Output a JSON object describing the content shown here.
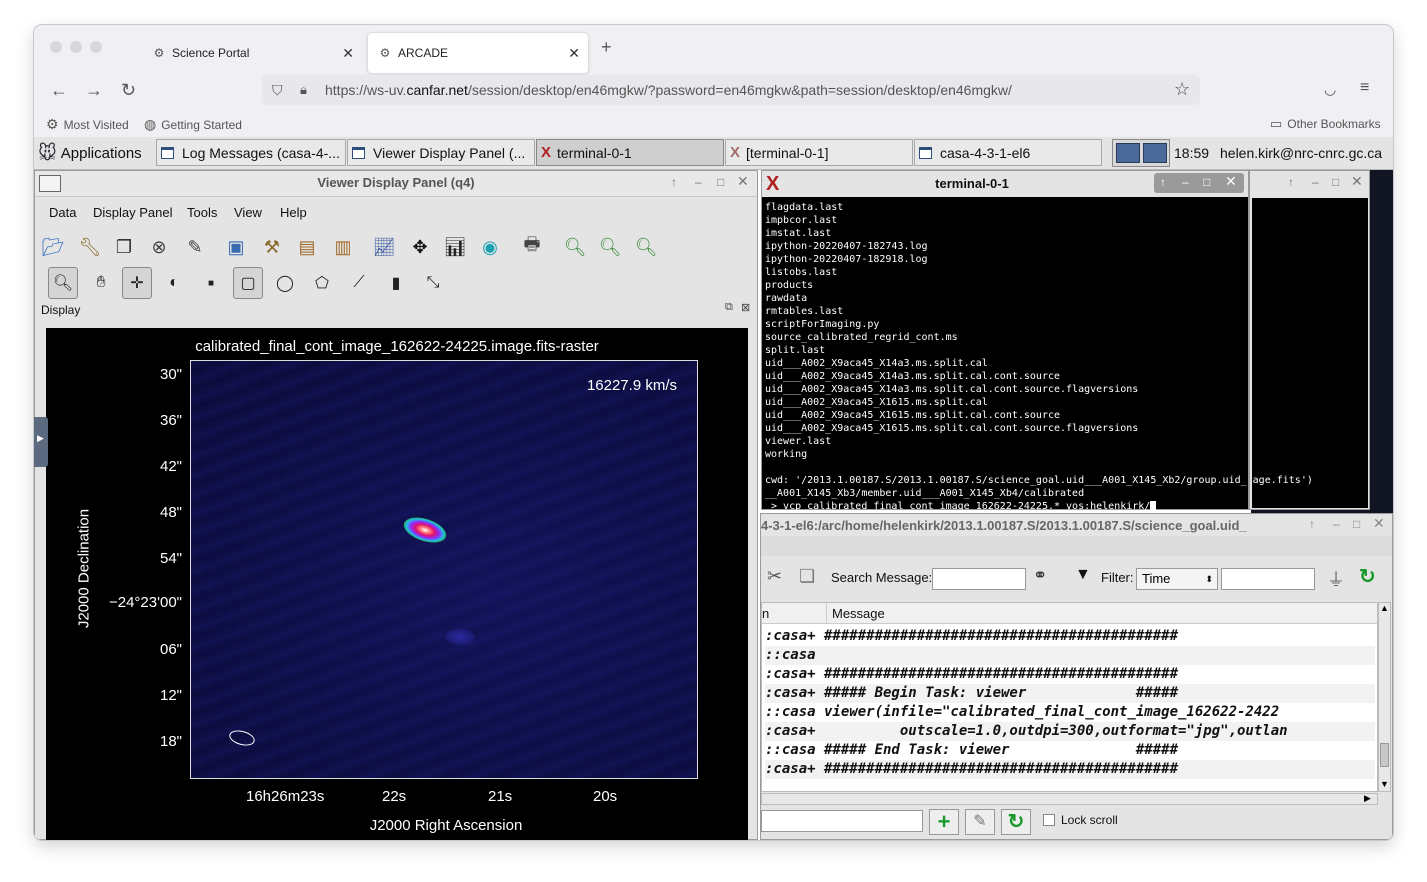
{
  "browser": {
    "tabs": [
      {
        "label": "Science Portal"
      },
      {
        "label": "ARCADE"
      }
    ],
    "url": {
      "prefix": "https://ws-uv.",
      "host": "canfar.net",
      "path": "/session/desktop/en46mgkw/?password=en46mgkw&path=session/desktop/en46mgkw/"
    },
    "bookmarks": {
      "most_visited": "Most Visited",
      "getting_started": "Getting Started",
      "other": "Other Bookmarks"
    }
  },
  "panel": {
    "applications": "Applications",
    "tasks": [
      {
        "label": "Log Messages (casa-4-..."
      },
      {
        "label": "Viewer Display Panel (..."
      },
      {
        "label": "terminal-0-1"
      },
      {
        "label": "[terminal-0-1]"
      },
      {
        "label": "casa-4-3-1-el6"
      }
    ],
    "clock": "18:59",
    "user": "helen.kirk@nrc-cnrc.gc.ca"
  },
  "viewer": {
    "title": "Viewer Display Panel (q4)",
    "menus": [
      "Data",
      "Display Panel",
      "Tools",
      "View",
      "Help"
    ],
    "display_label": "Display",
    "image_title": "calibrated_final_cont_image_162622-24225.image.fits-raster",
    "velocity": "16227.9 km/s",
    "ylabel": "J2000 Declination",
    "xlabel": "J2000 Right Ascension",
    "yticks": [
      "30\"",
      "36\"",
      "42\"",
      "48\"",
      "54\"",
      "−24°23'00\"",
      "06\"",
      "12\"",
      "18\""
    ],
    "xticks": [
      "16h26m23s",
      "22s",
      "21s",
      "20s"
    ]
  },
  "terminal": {
    "title": "terminal-0-1",
    "lines": [
      "flagdata.last",
      "impbcor.last",
      "imstat.last",
      "ipython-20220407-182743.log",
      "ipython-20220407-182918.log",
      "listobs.last",
      "products",
      "rawdata",
      "rmtables.last",
      "scriptForImaging.py",
      "source_calibrated_regrid_cont.ms",
      "split.last",
      "uid___A002_X9aca45_X14a3.ms.split.cal",
      "uid___A002_X9aca45_X14a3.ms.split.cal.cont.source",
      "uid___A002_X9aca45_X14a3.ms.split.cal.cont.source.flagversions",
      "uid___A002_X9aca45_X1615.ms.split.cal",
      "uid___A002_X9aca45_X1615.ms.split.cal.cont.source",
      "uid___A002_X9aca45_X1615.ms.split.cal.cont.source.flagversions",
      "viewer.last",
      "working",
      "",
      "cwd: '/2013.1.00187.S/2013.1.00187.S/science_goal.uid___A001_X145_Xb2/group.uid_ age.fits')",
      "__A001_X145_Xb3/member.uid___A001_X145_Xb4/calibrated",
      " > vcp calibrated_final_cont_image_162622-24225.* vos:helenkirk/"
    ]
  },
  "log": {
    "title": "4-3-1-el6:/arc/home/helenkirk/2013.1.00187.S/2013.1.00187.S/science_goal.uid_",
    "search_label": "Search Message:",
    "filter_label": "Filter:",
    "filter_value": "Time",
    "col_origin": "n",
    "col_message": "Message",
    "rows": [
      ":casa+ ##########################################",
      "::casa",
      ":casa+ ##########################################",
      ":casa+ ##### Begin Task: viewer             #####",
      "::casa viewer(infile=\"calibrated_final_cont_image_162622-2422",
      ":casa+          outscale=1.0,outdpi=300,outformat=\"jpg\",outlan",
      "::casa ##### End Task: viewer               #####",
      ":casa+ ##########################################"
    ],
    "lock_scroll": "Lock scroll"
  }
}
